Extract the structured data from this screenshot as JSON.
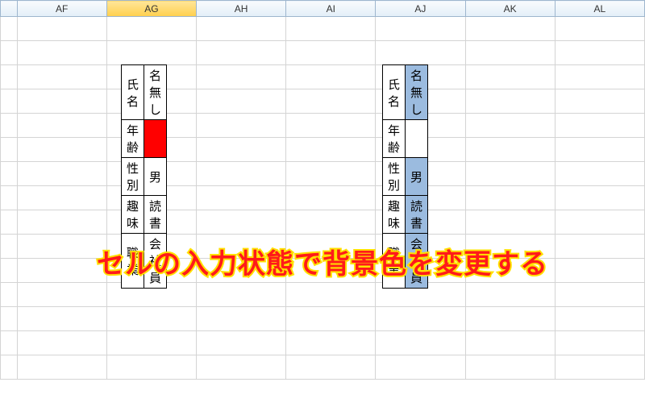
{
  "columns": [
    "AF",
    "AG",
    "AH",
    "AI",
    "AJ",
    "AK",
    "AL"
  ],
  "active_column": "AG",
  "table1": {
    "position": "left",
    "rows": [
      {
        "label": "氏名",
        "value": "名無し",
        "bg": "none"
      },
      {
        "label": "年齢",
        "value": "",
        "bg": "red"
      },
      {
        "label": "性別",
        "value": "男",
        "bg": "none"
      },
      {
        "label": "趣味",
        "value": "読書",
        "bg": "none"
      },
      {
        "label": "職業",
        "value": "会社員",
        "bg": "none"
      }
    ]
  },
  "table2": {
    "position": "right",
    "rows": [
      {
        "label": "氏名",
        "value": "名無し",
        "bg": "blue"
      },
      {
        "label": "年齢",
        "value": "",
        "bg": "none"
      },
      {
        "label": "性別",
        "value": "男",
        "bg": "blue"
      },
      {
        "label": "趣味",
        "value": "読書",
        "bg": "blue"
      },
      {
        "label": "職業",
        "value": "会社員",
        "bg": "blue"
      }
    ]
  },
  "caption": "セルの入力状態で背景色を変更する",
  "colors": {
    "highlight_red": "#ff0000",
    "highlight_blue": "#9bbbdf",
    "active_header": "#ffcf4d"
  }
}
